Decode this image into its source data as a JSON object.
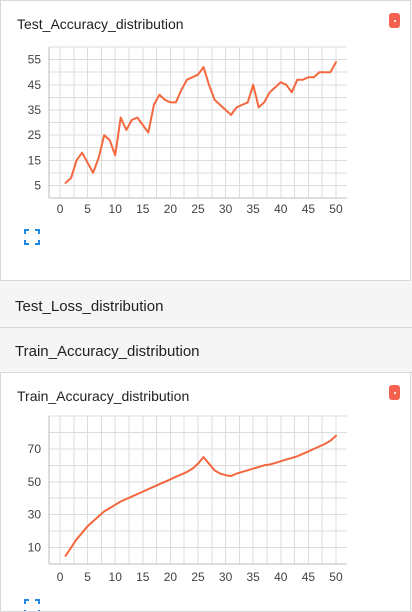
{
  "theme": {
    "accent": "#f4624f",
    "line_color": "#f4673f"
  },
  "headers": {
    "test_loss": "Test_Loss_distribution",
    "train_accuracy": "Train_Accuracy_distribution"
  },
  "cards": [
    {
      "title": "Test_Accuracy_distribution",
      "menu_icon": "dot-menu-icon",
      "expand_icon": "expand-icon"
    },
    {
      "title": "Train_Accuracy_distribution",
      "menu_icon": "dot-menu-icon",
      "expand_icon": "expand-icon"
    }
  ],
  "chart_data": [
    {
      "type": "line",
      "title": "Test_Accuracy_distribution",
      "xlim": [
        -2,
        52
      ],
      "ylim": [
        0,
        60
      ],
      "xticks": [
        0,
        5,
        10,
        15,
        20,
        25,
        30,
        35,
        40,
        45,
        50
      ],
      "yticks": [
        5,
        15,
        25,
        35,
        45,
        55
      ],
      "grid": true,
      "x": [
        1,
        2,
        3,
        4,
        5,
        6,
        7,
        8,
        9,
        10,
        11,
        12,
        13,
        14,
        15,
        16,
        17,
        18,
        19,
        20,
        21,
        22,
        23,
        24,
        25,
        26,
        27,
        28,
        29,
        30,
        31,
        32,
        33,
        34,
        35,
        36,
        37,
        38,
        39,
        40,
        41,
        42,
        43,
        44,
        45,
        46,
        47,
        48,
        49,
        50
      ],
      "values": [
        6,
        8,
        15,
        18,
        14,
        10,
        16,
        25,
        23,
        17,
        32,
        27,
        31,
        32,
        29,
        26,
        37,
        41,
        39,
        38,
        38,
        43,
        47,
        48,
        49,
        52,
        45,
        39,
        37,
        35,
        33,
        36,
        37,
        38,
        45,
        36,
        38,
        42,
        44,
        46,
        45,
        42,
        47,
        47,
        48,
        48,
        50,
        50,
        50,
        54
      ]
    },
    {
      "type": "line",
      "title": "Train_Accuracy_distribution",
      "xlim": [
        -2,
        52
      ],
      "ylim": [
        0,
        90
      ],
      "xticks": [
        0,
        5,
        10,
        15,
        20,
        25,
        30,
        35,
        40,
        45,
        50
      ],
      "yticks": [
        10,
        30,
        50,
        70
      ],
      "grid": true,
      "x": [
        1,
        2,
        3,
        4,
        5,
        6,
        7,
        8,
        9,
        10,
        11,
        12,
        13,
        14,
        15,
        16,
        17,
        18,
        19,
        20,
        21,
        22,
        23,
        24,
        25,
        26,
        27,
        28,
        29,
        30,
        31,
        32,
        33,
        34,
        35,
        36,
        37,
        38,
        39,
        40,
        41,
        42,
        43,
        44,
        45,
        46,
        47,
        48,
        49,
        50
      ],
      "values": [
        5,
        10,
        15,
        19,
        23,
        26,
        29,
        32,
        34,
        36,
        38,
        39.5,
        41,
        42.5,
        44,
        45.5,
        47,
        48.5,
        50,
        51.5,
        53,
        54.5,
        56,
        58,
        61,
        65,
        61,
        57,
        55,
        54,
        53.5,
        55,
        56,
        57,
        58,
        59,
        60,
        60.5,
        61.5,
        62.5,
        63.5,
        64.5,
        65.5,
        67,
        68.5,
        70,
        71.5,
        73,
        75,
        78
      ]
    }
  ]
}
